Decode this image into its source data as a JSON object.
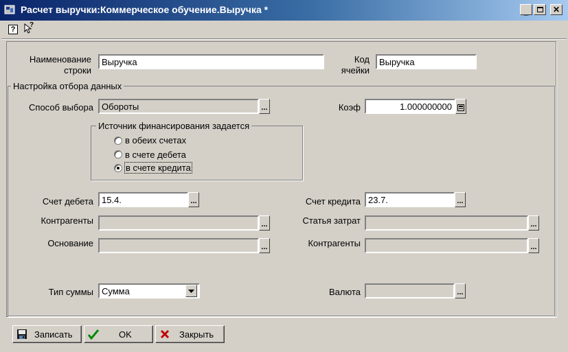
{
  "window": {
    "title": "Расчет выручки:Коммерческое обучение.Выручка *"
  },
  "toolbar": {
    "help_icon": "?",
    "whatsthis_icon": "?"
  },
  "form": {
    "row_name_label": "Наименование строки",
    "row_name_label_1": "Наименование",
    "row_name_label_2": "строки",
    "row_name_value": "Выручка",
    "cell_code_label_1": "Код",
    "cell_code_label_2": "ячейки",
    "cell_code_value": "Выручка"
  },
  "filter": {
    "group_title": "Настройка отбора данных",
    "method_label": "Способ выбора",
    "method_value": "Обороты",
    "coef_label": "Коэф",
    "coef_value": "1.000000000",
    "source": {
      "group_title": "Источник финансирования задается",
      "options": [
        "в обеих счетах",
        "в счете дебета",
        "в счете кредита"
      ],
      "selected": 2
    },
    "debit_label": "Счет дебета",
    "debit_value": "15.4.",
    "credit_label": "Счет кредита",
    "credit_value": "23.7.",
    "contractors_left_label": "Контрагенты",
    "expense_label": "Статья затрат",
    "basis_label": "Основание",
    "contractors_right_label": "Контрагенты",
    "sum_type_label": "Тип суммы",
    "sum_type_value": "Сумма",
    "currency_label": "Валюта"
  },
  "buttons": {
    "save": "Записать",
    "ok": "OK",
    "close": "Закрыть"
  }
}
